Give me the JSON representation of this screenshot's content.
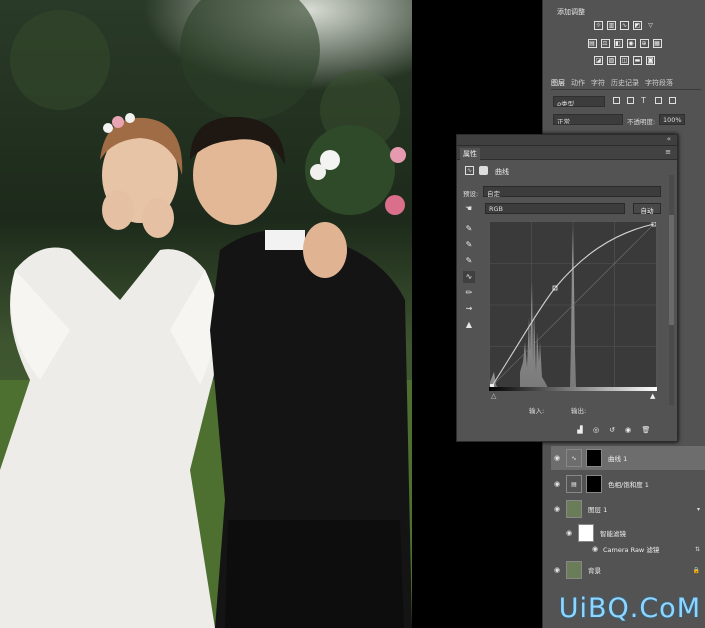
{
  "adjustments": {
    "title": "添加调整"
  },
  "layers_tabs": [
    "图层",
    "动作",
    "字符",
    "历史记录",
    "字符段落"
  ],
  "layers_controls": {
    "kind": "ρ类型",
    "blend_mode": "正常",
    "opacity_label": "不透明度:",
    "opacity_value": "100%"
  },
  "layers": [
    {
      "name": "曲线 1"
    },
    {
      "name": "色相/饱和度 1"
    },
    {
      "name": "图层 1"
    },
    {
      "name": "智能滤镜"
    },
    {
      "name": "Camera Raw 滤镜"
    },
    {
      "name": "背景"
    }
  ],
  "properties": {
    "tab_label": "属性",
    "panel_label": "曲线",
    "preset_label": "预设:",
    "preset_value": "自定",
    "channel_value": "RGB",
    "auto_button": "自动",
    "input_label": "输入:",
    "output_label": "输出:"
  },
  "icons": {
    "eye": "eye-icon",
    "lock": "lock-icon"
  },
  "colors": {
    "panel_bg": "#535353",
    "curve": "#cfcfcf",
    "watermark": "#8fd6ff"
  },
  "watermark": "UiBQ.CoM"
}
